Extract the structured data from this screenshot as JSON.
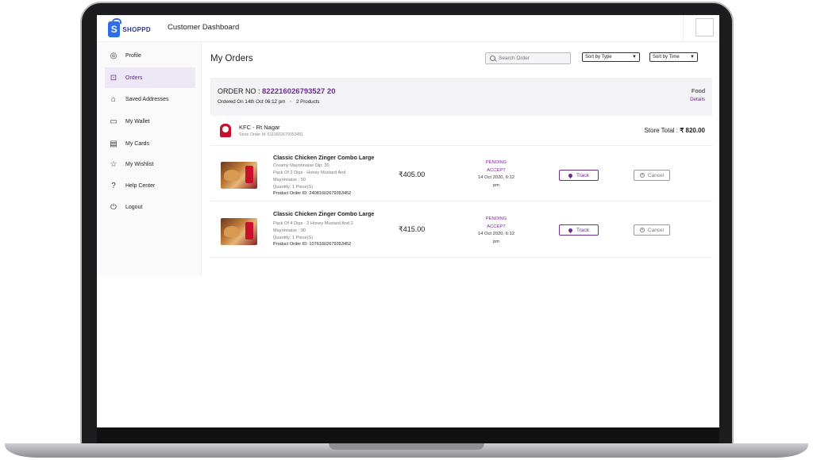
{
  "header": {
    "logo_text": "SHOPPD",
    "logo_letter": "S",
    "title": "Customer Dashboard"
  },
  "sidebar": {
    "items": [
      {
        "label": "Profile",
        "icon": "user-circle-icon"
      },
      {
        "label": "Orders",
        "icon": "bag-icon",
        "active": true
      },
      {
        "label": "Saved Addresses",
        "icon": "home-icon"
      },
      {
        "label": "My Wallet",
        "icon": "wallet-icon"
      },
      {
        "label": "My Cards",
        "icon": "card-icon"
      },
      {
        "label": "My Wishlist",
        "icon": "star-icon"
      },
      {
        "label": "Help Center",
        "icon": "help-icon"
      },
      {
        "label": "Logout",
        "icon": "power-icon"
      }
    ]
  },
  "main": {
    "title": "My Orders",
    "search_placeholder": "Search Order",
    "sort_type": "Sort by Type",
    "sort_time": "Sort by Time"
  },
  "order": {
    "label": "ORDER NO : ",
    "number": "822216026793527 20",
    "meta": "Ordered On 14th Oct 06:12 pm",
    "products": "2 Products",
    "type": "Food",
    "details": "Details"
  },
  "store": {
    "name": "KFC - Rt Nagar",
    "order_id": "Store Order Id: 6111602679353451",
    "total_label": "Store Total : ",
    "total_value": "₹ 820.00"
  },
  "items": [
    {
      "name": "Classic Chicken Zinger Combo Large",
      "desc": [
        "Creamy Mayonnaise Dip: 30",
        "Pack Of 2 Dips - Honey Mustard And",
        "Mayonnaise : 50",
        "Quantity: 1 Piece(S)"
      ],
      "pid": "Product Order ID: 24081602679353452",
      "price": "₹405.00",
      "status1": "PENDING",
      "status2": "ACCEPT",
      "date1": "14 Oct 2020, 6:12",
      "date2": "pm",
      "track": "Track",
      "cancel": "Cancel"
    },
    {
      "name": "Classic Chicken Zinger Combo Large",
      "desc": [
        "Pack Of 4 Dips - 2 Honey Mustard And 2",
        "Mayonnaise : 90",
        "Quantity: 1 Piece(S)"
      ],
      "pid": "Product Order ID: 10761602679353452",
      "price": "₹415.00",
      "status1": "PENDING",
      "status2": "ACCEPT",
      "date1": "14 Oct 2020, 6:12",
      "date2": "pm",
      "track": "Track",
      "cancel": "Cancel"
    }
  ]
}
